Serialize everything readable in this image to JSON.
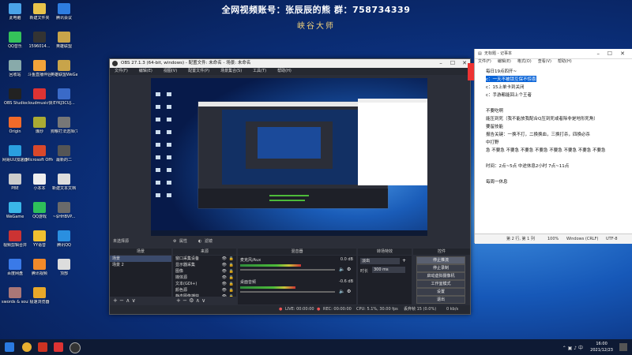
{
  "banner": {
    "line1": "全网视频账号：张辰辰的熊  群：758734339",
    "line2": "峡谷大师"
  },
  "desktop_icons": [
    {
      "label": "此电脑",
      "color": "#4aa3e8"
    },
    {
      "label": "新建文件夹",
      "color": "#e8c34a"
    },
    {
      "label": "腾讯会议",
      "color": "#2e7de0"
    },
    {
      "label": "QQ音乐",
      "color": "#34c25a"
    },
    {
      "label": "1596014...",
      "color": "#333"
    },
    {
      "label": "英雄联盟",
      "color": "#c8a44a"
    },
    {
      "label": "回收站",
      "color": "#8aa"
    },
    {
      "label": "斗鱼直播伴侣",
      "color": "#f2a33a"
    },
    {
      "label": "英雄联盟WeGame版",
      "color": "#c8a44a"
    },
    {
      "label": "OBS Studio",
      "color": "#222"
    },
    {
      "label": "cloudmusic快捷方式",
      "color": "#d33"
    },
    {
      "label": "EYKJ3CUJ...",
      "color": "#3a6ac8"
    },
    {
      "label": "Origin",
      "color": "#f06a2a"
    },
    {
      "label": "爆炒",
      "color": "#aa3"
    },
    {
      "label": "狗粮打法选择(7.12更新)",
      "color": "#777"
    },
    {
      "label": "网易UU加速器",
      "color": "#2aa0e0"
    },
    {
      "label": "Microsoft Office",
      "color": "#d9482b"
    },
    {
      "label": "最新的二",
      "color": "#555"
    },
    {
      "label": "PBE",
      "color": "#ccc"
    },
    {
      "label": "小本本",
      "color": "#eee"
    },
    {
      "label": "新建文本文档",
      "color": "#ddd"
    },
    {
      "label": "WeGame",
      "color": "#3ab6e8"
    },
    {
      "label": "QQ游戏",
      "color": "#2ec05a"
    },
    {
      "label": "~$HHBVP...",
      "color": "#6a6a6a"
    },
    {
      "label": "视频剪辑合并",
      "color": "#c33"
    },
    {
      "label": "YY语音",
      "color": "#f0c030"
    },
    {
      "label": "腾讯QQ",
      "color": "#2a8fe0"
    },
    {
      "label": "百度网盘",
      "color": "#3a7ae8"
    },
    {
      "label": "腾讯视频",
      "color": "#f28a2a"
    },
    {
      "label": "顶部",
      "color": "#ddd"
    },
    {
      "label": "swords & souls ne...",
      "color": "#a77"
    },
    {
      "label": "极速浏览器",
      "color": "#e8a82a"
    }
  ],
  "obs": {
    "title": "OBS 27.1.3 (64-bit, windows) - 配置文件: 未命名 - 场景: 未命名",
    "menu": [
      "文件(F)",
      "编辑(E)",
      "视图(V)",
      "配置文件(P)",
      "场景集合(S)",
      "工具(T)",
      "帮助(H)"
    ],
    "source_bar": {
      "label": "未选择源",
      "props": "属性",
      "filters": "滤镜"
    },
    "panels": {
      "scenes": "场景",
      "sources": "来源",
      "mixer": "混音器",
      "transitions": "转场特效",
      "controls": "控件"
    },
    "scenes": [
      "场景",
      "场景 2"
    ],
    "sources": [
      "窗口采集设备",
      "显示器采集",
      "图像",
      "媒体源",
      "文本(GDI+)",
      "颜色源",
      "静态图像捕获"
    ],
    "mixer": [
      {
        "name": "麦克风/Aux",
        "db": "0.0 dB",
        "level": 0.55
      },
      {
        "name": "桌面音频",
        "db": "-0.6 dB",
        "level": 0.5
      }
    ],
    "transition": {
      "type": "淡出",
      "duration_label": "时长",
      "duration": "300 ms"
    },
    "controls": [
      "停止推流",
      "停止录制",
      "启动虚拟摄像机",
      "工作室模式",
      "设置",
      "退出"
    ],
    "status": {
      "live": "LIVE: 00:00:00",
      "rec": "REC: 00:00:00",
      "cpu": "CPU: 5.1%, 30.00 fps",
      "dropped": "丢弃帧 15 (0.0%)",
      "kbps": "0 kb/s"
    }
  },
  "notepad": {
    "title": "无标题 - 记事本",
    "menu": [
      "文件(F)",
      "编辑(E)",
      "格式(O)",
      "查看(V)",
      "帮助(H)"
    ],
    "lines": [
      {
        "text": "每日19点四开~",
        "highlight": false
      },
      {
        "text": "c：一天不被锁互保不惊喜",
        "highlight": true
      },
      {
        "text": "c：15上单卡到关闭",
        "highlight": false
      },
      {
        "text": "c：手游都能回上个王者",
        "highlight": false
      },
      {
        "text": "",
        "highlight": false
      },
      {
        "text": "不要吃啊",
        "highlight": false
      },
      {
        "text": "能压到死（我不能放我配合Q压到死或者除非是地形死角）",
        "highlight": false
      },
      {
        "text": "要留技能",
        "highlight": false
      },
      {
        "text": "报告关键：一换不打，二换换血，三换打杀，四换必杀",
        "highlight": false
      },
      {
        "text": "中打野",
        "highlight": false
      },
      {
        "text": "急 不要急 不要急 不要急 不要急 不要急 不要急 不要急 不要急",
        "highlight": false
      },
      {
        "text": "",
        "highlight": false
      },
      {
        "text": "时间：2点~5点  中途休息2小时  7点~11点",
        "highlight": false
      },
      {
        "text": "",
        "highlight": false
      },
      {
        "text": "每周一休息",
        "highlight": false
      }
    ],
    "status": {
      "pos": "第 2 行, 第 1 列",
      "zoom": "100%",
      "eol": "Windows (CRLF)",
      "enc": "UTF-8"
    }
  },
  "taskbar": {
    "time": "16:00",
    "date": "2021/12/23"
  }
}
